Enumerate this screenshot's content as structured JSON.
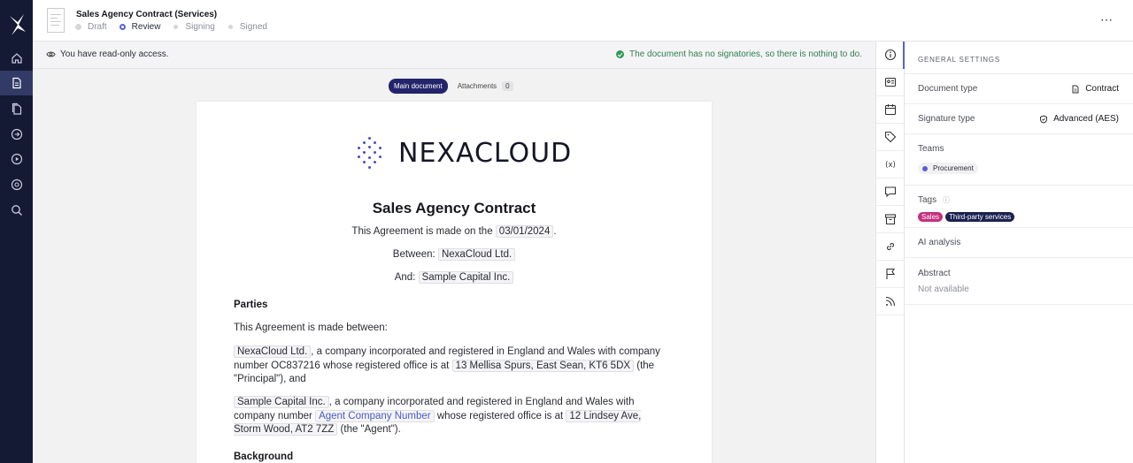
{
  "document": {
    "title": "Sales Agency Contract (Services)",
    "steps": [
      {
        "label": "Draft",
        "state": "done"
      },
      {
        "label": "Review",
        "state": "current"
      },
      {
        "label": "Signing",
        "state": "upcoming"
      },
      {
        "label": "Signed",
        "state": "upcoming"
      }
    ]
  },
  "nav": {
    "items": [
      "home-icon",
      "document-icon",
      "documents-icon",
      "templates-icon",
      "play-icon",
      "integrations-icon",
      "search-icon"
    ],
    "active": "document-icon"
  },
  "notice": {
    "access": "You have read-only access.",
    "status": "The document has no signatories, so there is nothing to do."
  },
  "doc_tabs": {
    "main": "Main document",
    "attachments": "Attachments",
    "attachments_count": "0"
  },
  "contract": {
    "brand": "NEXACLOUD",
    "heading": "Sales Agency Contract",
    "made_on_prefix": "This Agreement is made on the",
    "date": "03/01/2024",
    "made_on_suffix": ".",
    "between_label": "Between:",
    "between_party": "NexaCloud Ltd.",
    "and_label": "And:",
    "and_party": "Sample Capital Inc.",
    "parties_heading": "Parties",
    "parties_intro": "This Agreement is made between:",
    "party1": {
      "name": "NexaCloud Ltd.",
      "text1": ", a company incorporated and registered in England and Wales with company number OC837216 whose registered office is at",
      "address": "13 Mellisa Spurs, East Sean, KT6 5DX",
      "text2": "(the \"Principal\"), and"
    },
    "party2": {
      "name": "Sample Capital Inc.",
      "text1": ", a company incorporated and registered in England and Wales with company number",
      "company_number": "Agent Company Number",
      "text2": "whose registered office is at",
      "address": "12 Lindsey Ave, Storm Wood, AT2 7ZZ",
      "text3": "(the \"Agent\")."
    },
    "background_heading": "Background"
  },
  "rail": {
    "items": [
      "info-icon",
      "contacts-icon",
      "calendar-icon",
      "tag-icon",
      "variables-icon",
      "comments-icon",
      "archive-icon",
      "link-icon",
      "flag-icon",
      "feed-icon"
    ],
    "active": "info-icon"
  },
  "settings": {
    "heading": "GENERAL SETTINGS",
    "document_type_label": "Document type",
    "document_type_value": "Contract",
    "signature_type_label": "Signature type",
    "signature_type_value": "Advanced (AES)",
    "teams_label": "Teams",
    "team": "Procurement",
    "tags_label": "Tags",
    "tags": [
      {
        "label": "Sales",
        "color": "#c4307f"
      },
      {
        "label": "Third-party services",
        "color": "#1b2150"
      }
    ],
    "ai_label": "AI analysis",
    "abstract_label": "Abstract",
    "abstract_value": "Not available"
  },
  "colors": {
    "nav_bg": "#141a33",
    "accent": "#5661d6",
    "success": "#2f7f4f",
    "main_tab": "#23246b"
  }
}
